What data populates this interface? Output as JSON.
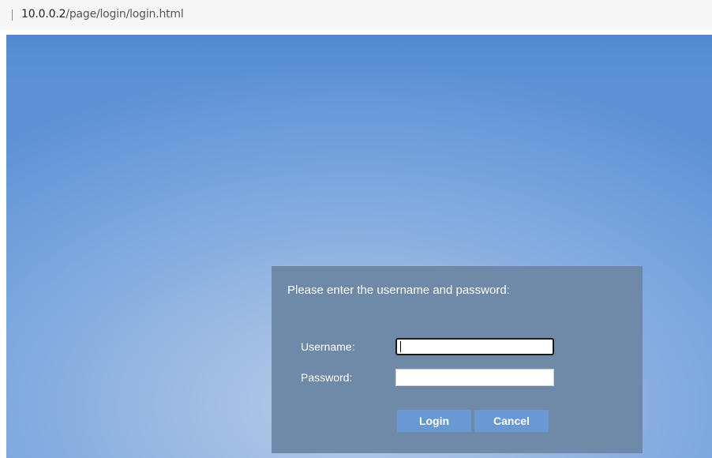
{
  "browser": {
    "url_host": "10.0.0.2",
    "url_path": "/page/login/login.html"
  },
  "login": {
    "prompt": "Please enter the username and password:",
    "username_label": "Username:",
    "password_label": "Password:",
    "username_value": "",
    "password_value": "",
    "login_button": "Login",
    "cancel_button": "Cancel"
  },
  "colors": {
    "background_gradient_center": "#b7cbe6",
    "background_gradient_edge": "#5d92d6",
    "login_panel": "#6f8aa8",
    "button": "#6a98d3"
  }
}
